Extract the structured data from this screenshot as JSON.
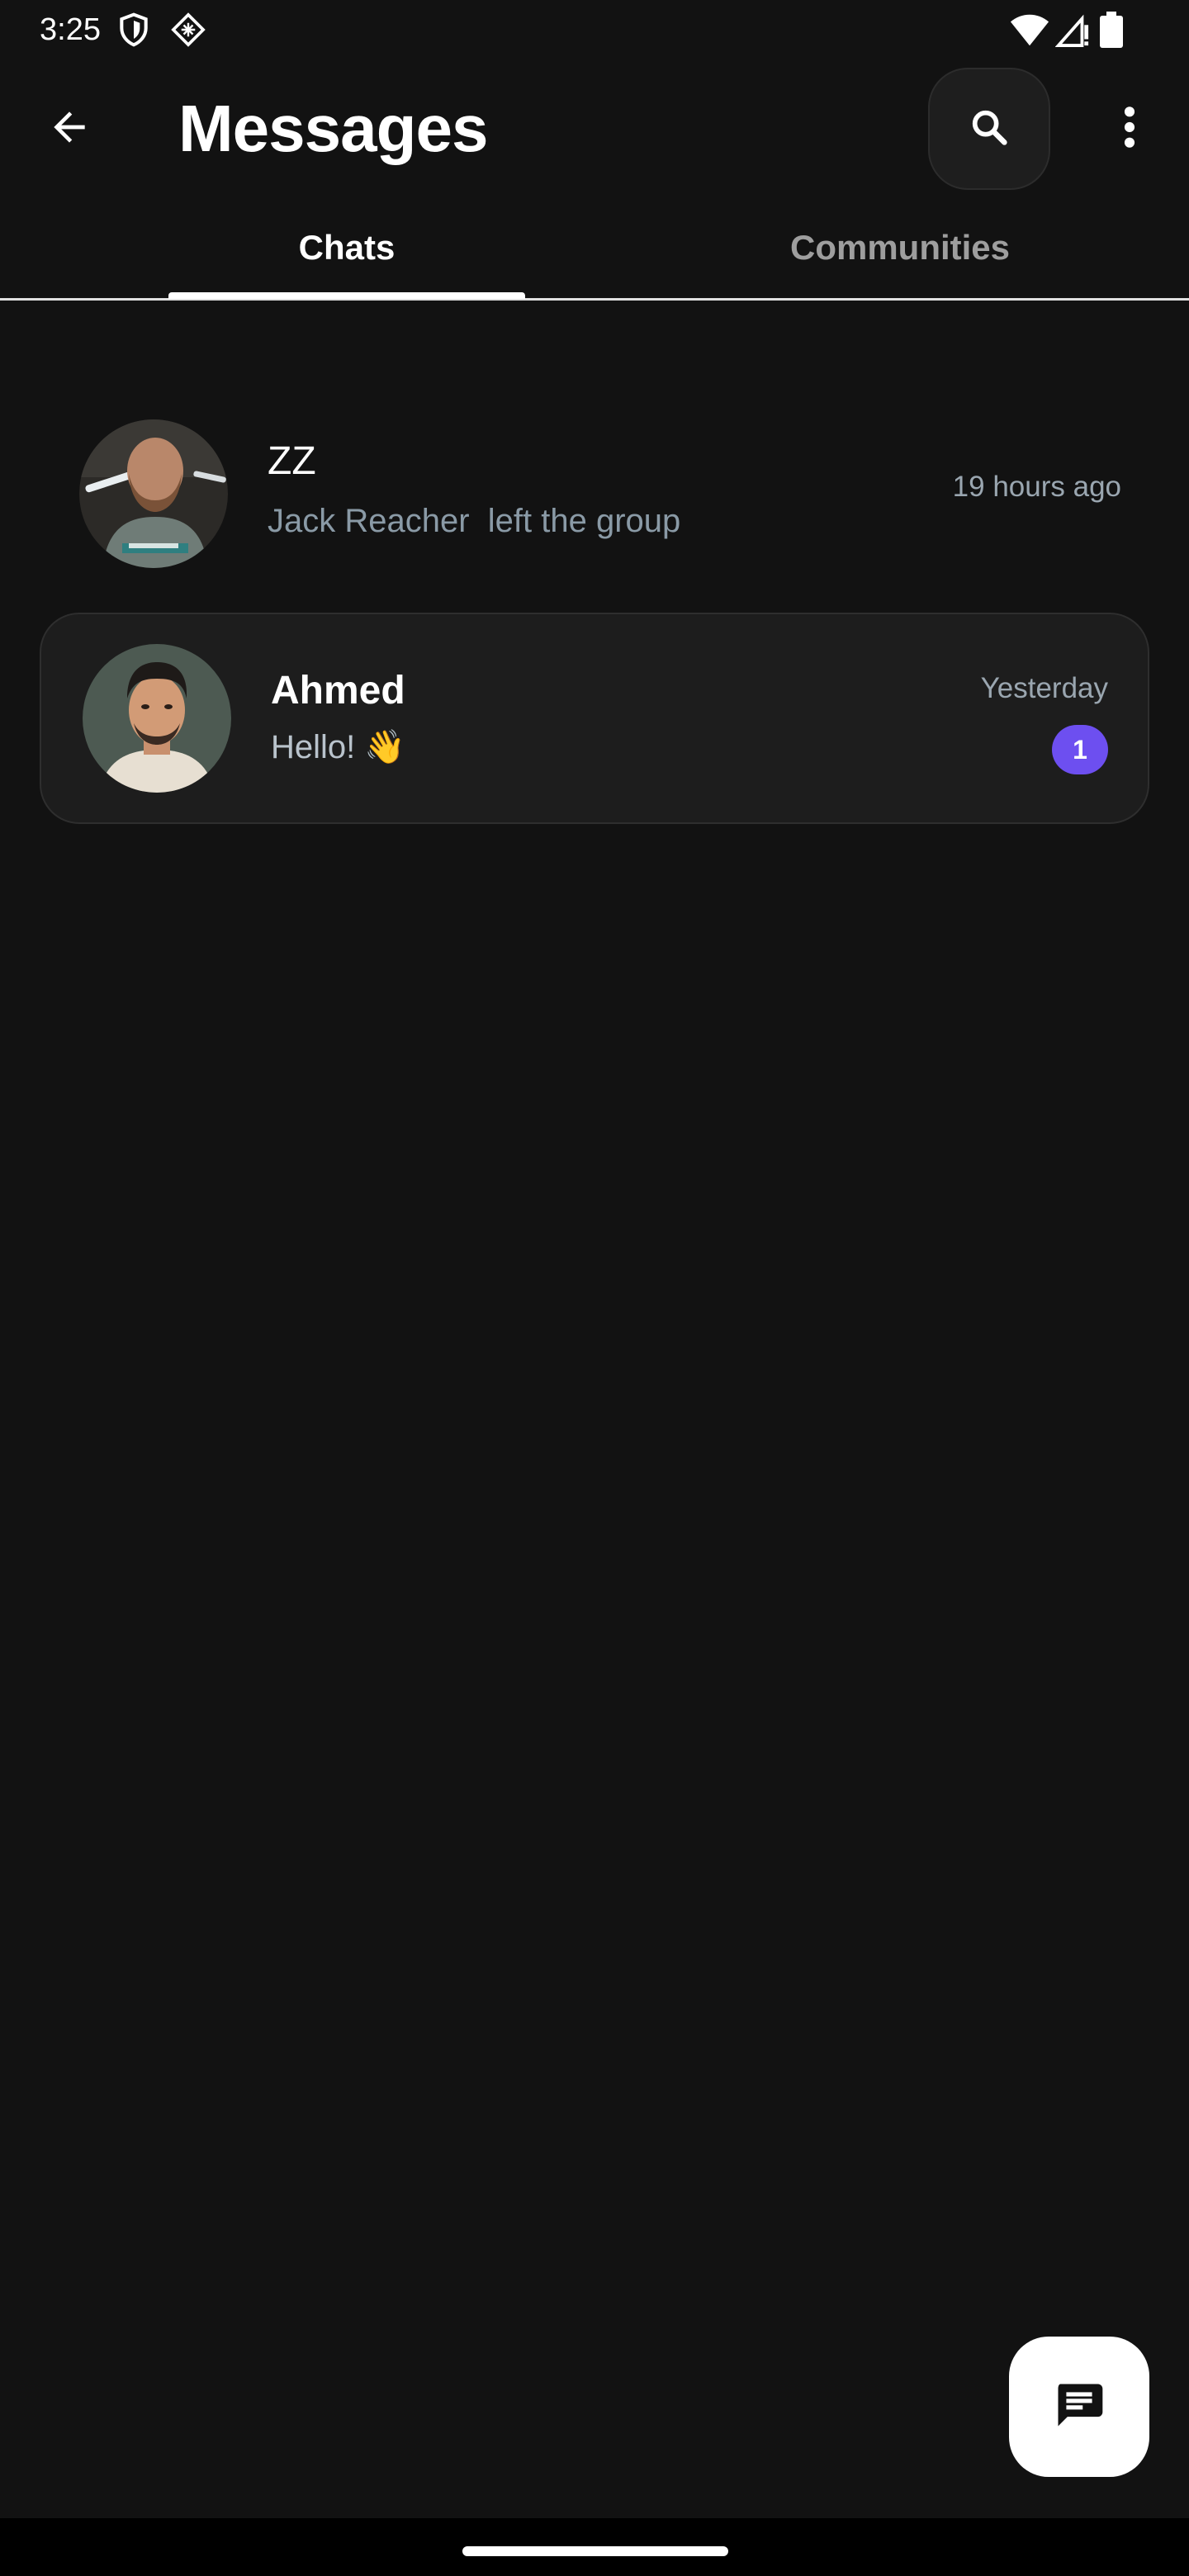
{
  "status_bar": {
    "time": "3:25",
    "left_icons": [
      "shield-icon",
      "app-notification-icon"
    ],
    "right_icons": [
      "wifi-icon",
      "cell-signal-icon",
      "battery-icon"
    ]
  },
  "app_bar": {
    "title": "Messages",
    "back_icon": "arrow-left-icon",
    "search_icon": "search-icon",
    "more_icon": "more-vert-icon"
  },
  "tabs": [
    {
      "label": "Chats",
      "selected": true
    },
    {
      "label": "Communities",
      "selected": false
    }
  ],
  "chats": [
    {
      "name": "ZZ",
      "preview": "Jack Reacher  left the group",
      "time": "19 hours ago",
      "unread": null
    },
    {
      "name": "Ahmed",
      "preview": "Hello! 👋",
      "time": "Yesterday",
      "unread": "1"
    }
  ],
  "fab": {
    "icon": "chat-icon"
  },
  "colors": {
    "background": "#121212",
    "card": "#1d1d1d",
    "accent": "#6d4ff0",
    "muted_text": "#8a9aa6"
  }
}
